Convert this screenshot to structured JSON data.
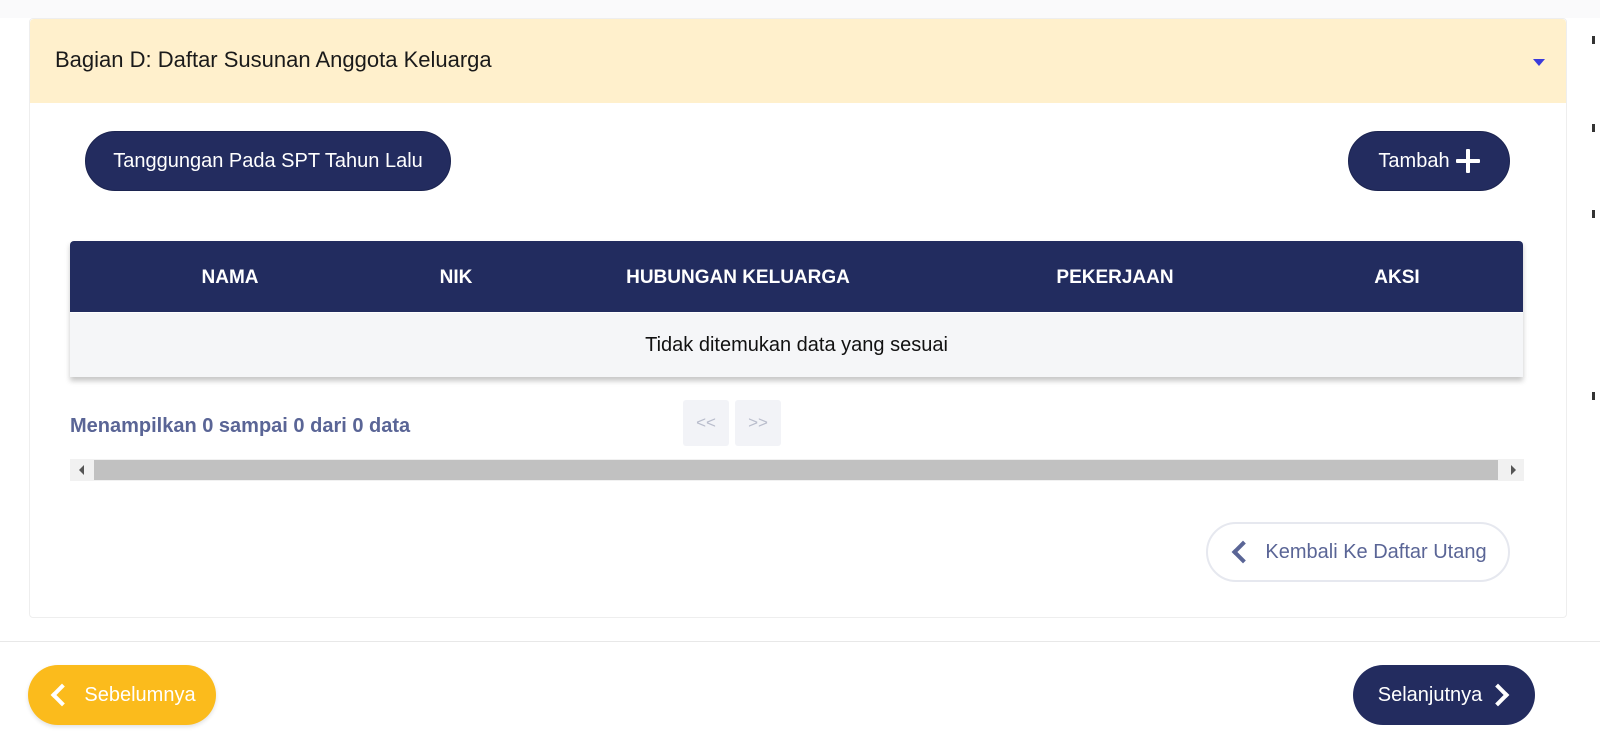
{
  "section": {
    "title": "Bagian D: Daftar Susunan Anggota Keluarga",
    "toggle_icon": "caret-down-icon"
  },
  "actions": {
    "tanggungan_label": "Tanggungan Pada SPT Tahun Lalu",
    "tambah_label": "Tambah",
    "tambah_icon": "plus-icon"
  },
  "table": {
    "columns": [
      "NAMA",
      "NIK",
      "HUBUNGAN KELUARGA",
      "PEKERJAAN",
      "AKSI"
    ],
    "empty_message": "Tidak ditemukan data yang sesuai"
  },
  "pagination": {
    "info": "Menampilkan 0 sampai 0 dari 0 data",
    "prev_label": "<<",
    "next_label": ">>"
  },
  "kembali_label": "Kembali Ke Daftar Utang",
  "footer": {
    "prev_label": "Sebelumnya",
    "next_label": "Selanjutnya"
  },
  "colors": {
    "header_bg": "#fff0cc",
    "primary": "#232c5f",
    "accent": "#fbbb1c",
    "muted_text": "#5a6596"
  }
}
